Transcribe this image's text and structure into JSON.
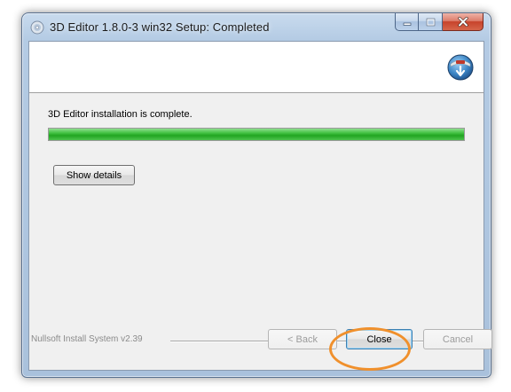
{
  "window": {
    "title": "3D Editor 1.8.0-3 win32 Setup: Completed",
    "icons": {
      "app": "installer-disc-icon",
      "header": "installer-globe-icon",
      "minimize": "minimize-icon",
      "maximize": "maximize-icon",
      "close": "close-icon"
    }
  },
  "main": {
    "status_text": "3D Editor installation is complete.",
    "progress_percent": 100,
    "progress_color": "#2fb12f",
    "show_details_label": "Show details"
  },
  "footer": {
    "brand": "Nullsoft Install System v2.39",
    "back_label": "< Back",
    "close_label": "Close",
    "cancel_label": "Cancel"
  },
  "annotation": {
    "color": "#f0902c",
    "target": "close-button"
  }
}
